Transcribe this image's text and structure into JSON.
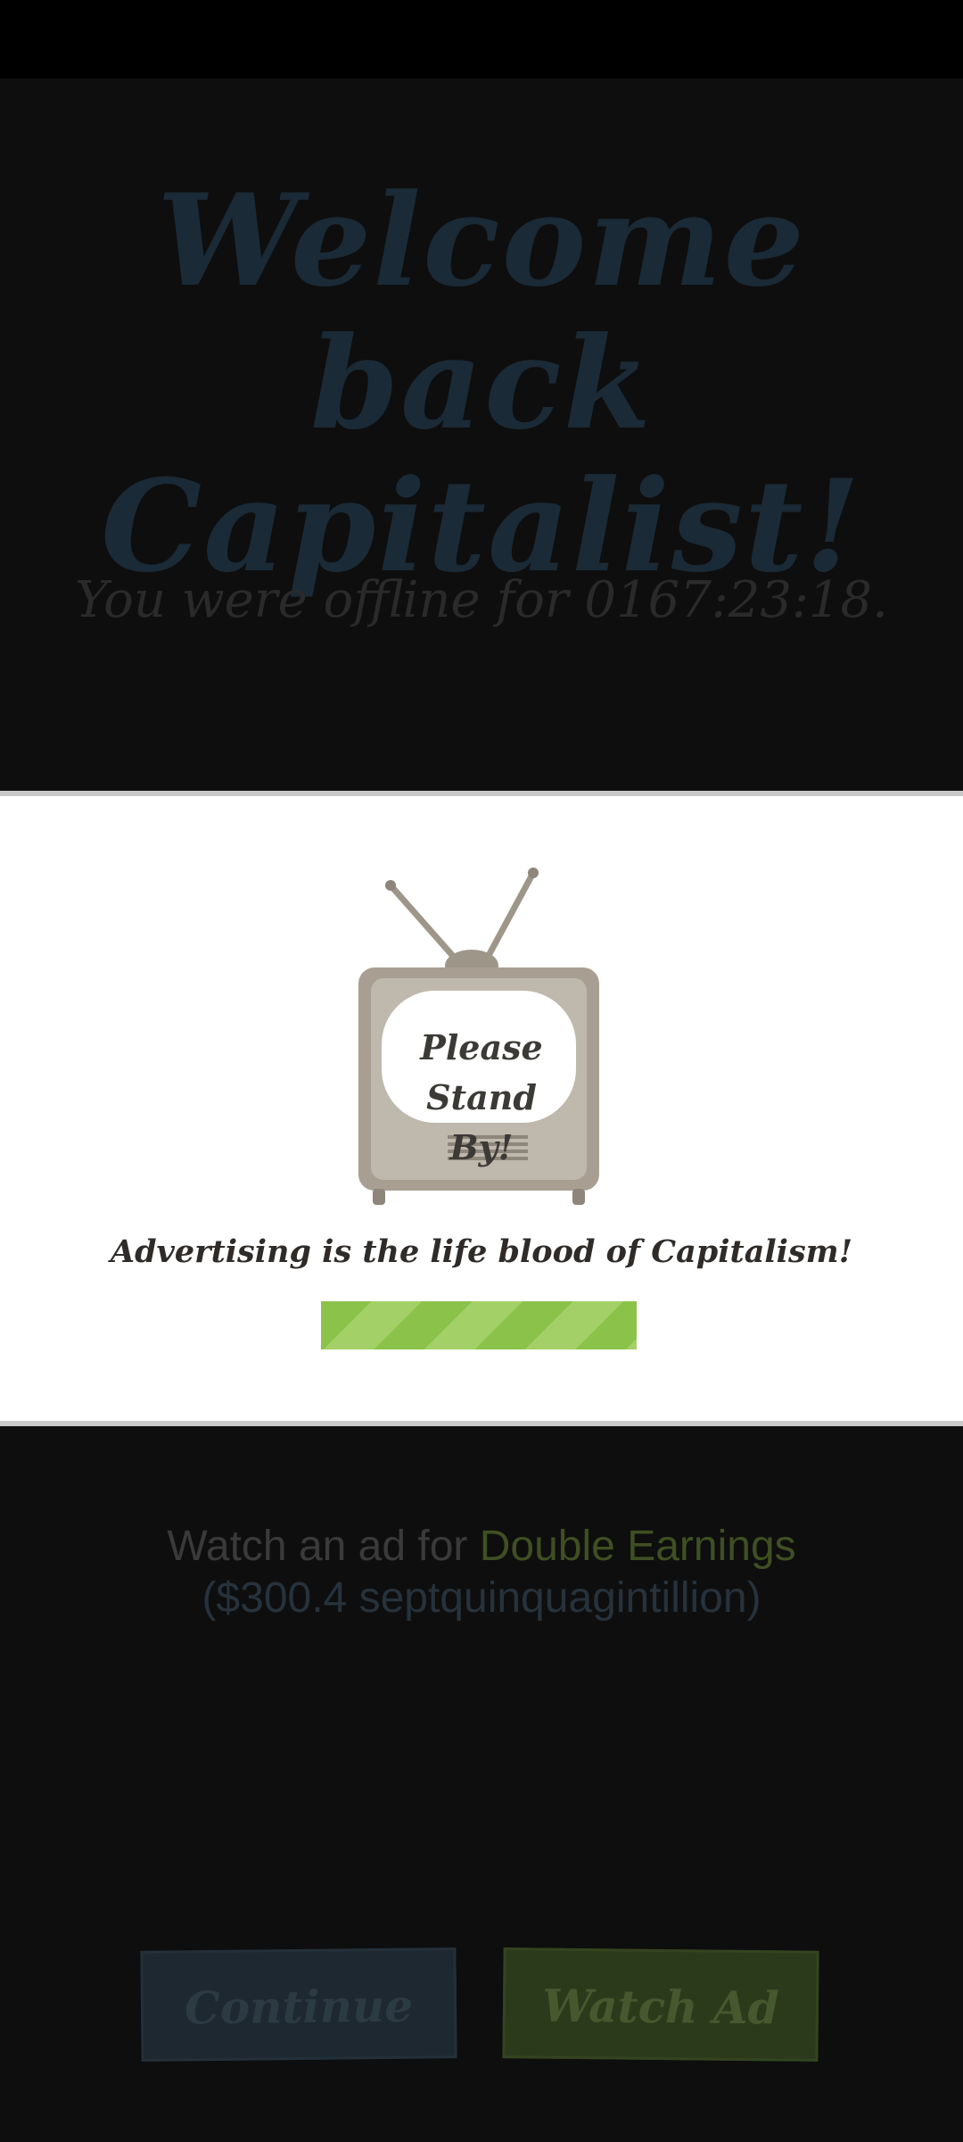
{
  "welcome": {
    "title_line1": "Welcome back",
    "title_line2": "Capitalist!"
  },
  "offline": {
    "text": "You were offline for 0167:23:18."
  },
  "modal": {
    "tv_text_line1": "Please",
    "tv_text_line2": "Stand By!",
    "caption": "Advertising is the life blood of Capitalism!",
    "progress": 1.0
  },
  "watch_offer": {
    "prefix": "Watch an ad for ",
    "highlight": "Double Earnings",
    "amount": " ($300.4 septquinquagintillion)"
  },
  "buttons": {
    "continue": "Continue",
    "watch_ad": "Watch Ad"
  },
  "colors": {
    "progress_green": "#8bc34a",
    "progress_green_light": "#a3d067",
    "modal_bg": "#ffffff",
    "overlay_bg": "#0e0e0e"
  }
}
